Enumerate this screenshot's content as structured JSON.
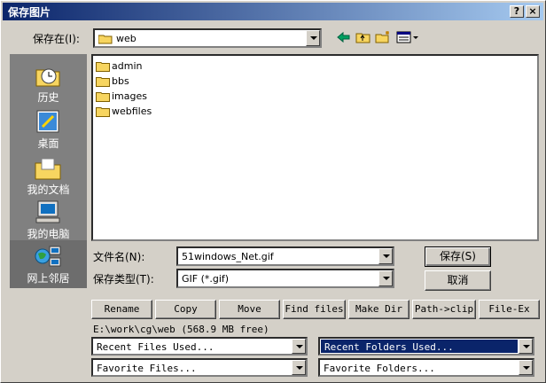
{
  "window": {
    "title": "保存图片",
    "help_label": "?",
    "close_label": "×"
  },
  "toolbar": {
    "save_in_label": "保存在(I):",
    "save_in_value": "web"
  },
  "places": [
    {
      "label": "历史",
      "icon": "history-icon"
    },
    {
      "label": "桌面",
      "icon": "desktop-icon"
    },
    {
      "label": "我的文档",
      "icon": "my-documents-icon"
    },
    {
      "label": "我的电脑",
      "icon": "my-computer-icon"
    },
    {
      "label": "网上邻居",
      "icon": "network-icon"
    }
  ],
  "files": [
    {
      "name": "admin"
    },
    {
      "name": "bbs"
    },
    {
      "name": "images"
    },
    {
      "name": "webfiles"
    }
  ],
  "form": {
    "filename_label": "文件名(N):",
    "filename_value": "51windows_Net.gif",
    "filetype_label": "保存类型(T):",
    "filetype_value": "GIF (*.gif)",
    "save_button": "保存(S)",
    "cancel_button": "取消"
  },
  "actions": [
    {
      "label": "Rename"
    },
    {
      "label": "Copy"
    },
    {
      "label": "Move"
    },
    {
      "label": "Find files"
    },
    {
      "label": "Make Dir"
    },
    {
      "label": "Path->clip"
    },
    {
      "label": "File-Ex"
    }
  ],
  "status": {
    "path_info": "E:\\work\\cg\\web   (568.9 MB free)"
  },
  "dropdowns": {
    "recent_files": "Recent Files Used...",
    "recent_folders": "Recent Folders Used...",
    "favorite_files": "Favorite Files...",
    "favorite_folders": "Favorite Folders..."
  },
  "colors": {
    "title_start": "#0a246a",
    "title_end": "#a6caf0",
    "face": "#d4d0c8",
    "places_bg": "#808080",
    "folder": "#f7d560"
  }
}
